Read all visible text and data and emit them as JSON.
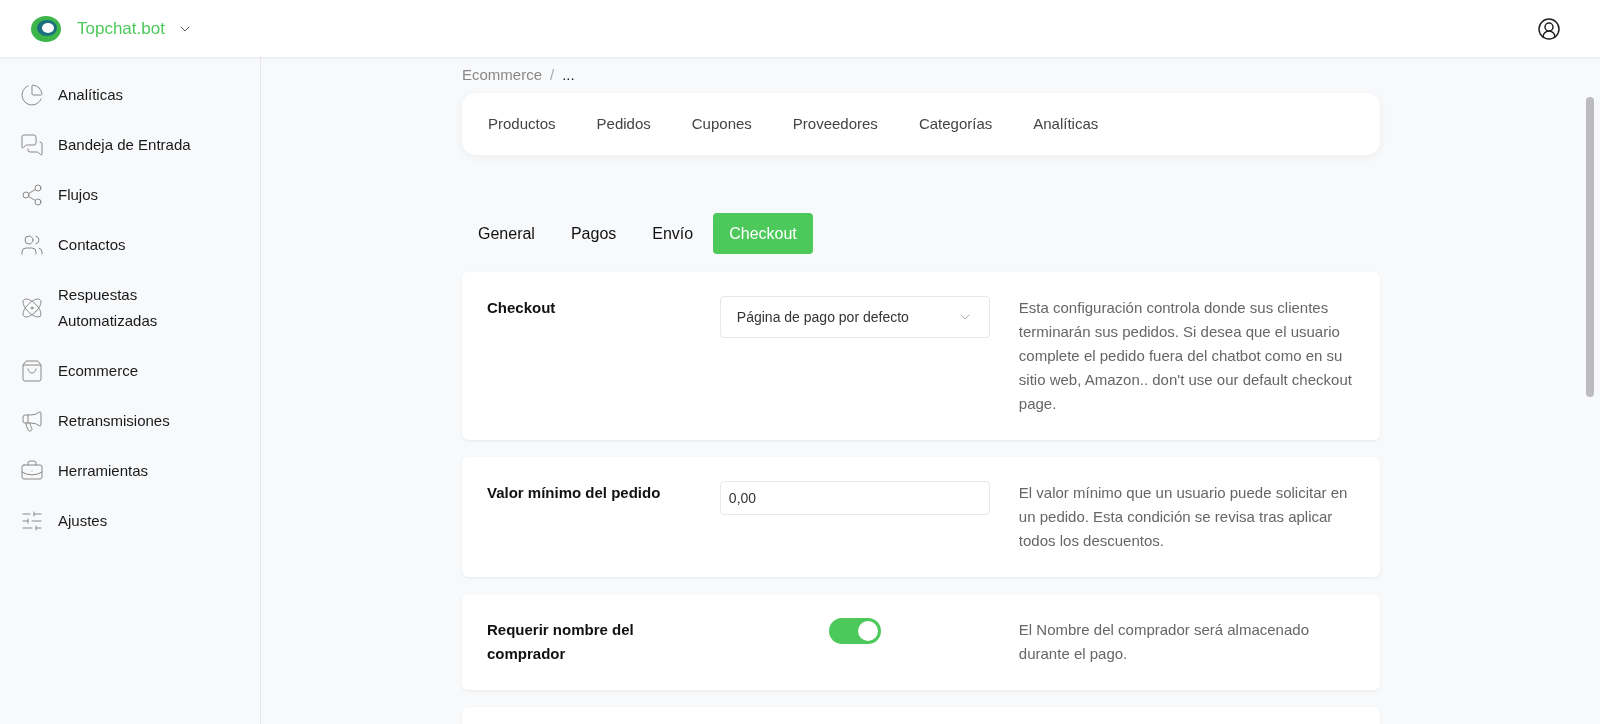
{
  "header": {
    "brand": "Topchat.bot"
  },
  "sidebar": {
    "items": [
      {
        "label": "Analíticas",
        "selected": false
      },
      {
        "label": "Bandeja de Entrada",
        "selected": false
      },
      {
        "label": "Flujos",
        "selected": false
      },
      {
        "label": "Contactos",
        "selected": false
      },
      {
        "label": "Respuestas Automatizadas",
        "selected": false
      },
      {
        "label": "Ecommerce",
        "selected": false
      },
      {
        "label": "Retransmisiones",
        "selected": false
      },
      {
        "label": "Herramientas",
        "selected": false
      },
      {
        "label": "Ajustes",
        "selected": false
      }
    ]
  },
  "breadcrumb": {
    "items": [
      "Ecommerce",
      "..."
    ],
    "separator": "/"
  },
  "nav": [
    {
      "label": "Productos",
      "selected": false
    },
    {
      "label": "Pedidos",
      "selected": false
    },
    {
      "label": "Cupones",
      "selected": false
    },
    {
      "label": "Proveedores",
      "selected": false
    },
    {
      "label": "Categorías",
      "selected": false
    },
    {
      "label": "Analíticas",
      "selected": false
    }
  ],
  "tabs": [
    {
      "label": "General",
      "selected": false
    },
    {
      "label": "Pagos",
      "selected": false
    },
    {
      "label": "Envío",
      "selected": false
    },
    {
      "label": "Checkout",
      "selected": true
    }
  ],
  "settings": [
    {
      "kind": "select",
      "label": "Checkout",
      "value": "Página de pago por defecto",
      "description": "Esta configuración controla donde sus clientes terminarán sus pedidos. Si desea que el usuario complete el pedido fuera del chatbot como en su sitio web, Amazon.. don't use our default checkout page."
    },
    {
      "kind": "input",
      "label": "Valor mínimo del pedido",
      "value": "0,00",
      "description": "El valor mínimo que un usuario puede solicitar en un pedido. Esta condición se revisa tras aplicar todos los descuentos."
    },
    {
      "kind": "toggle",
      "label": "Requerir nombre del comprador",
      "on": true,
      "description": "El Nombre del comprador será almacenado durante el pago."
    }
  ]
}
